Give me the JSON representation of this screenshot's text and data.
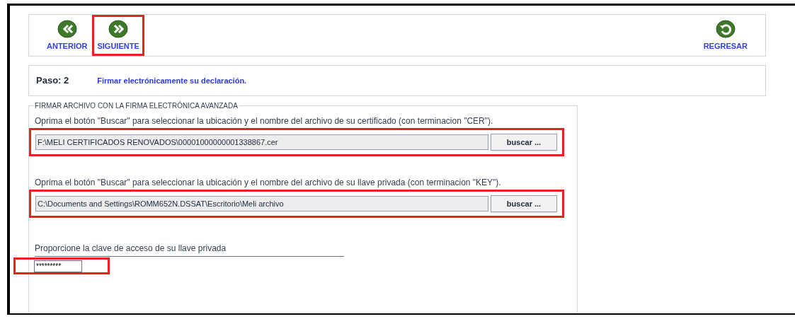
{
  "nav_buttons": [
    {
      "label": "ANTERIOR",
      "kind": "back",
      "highlighted": false
    },
    {
      "label": "SIGUIENTE",
      "kind": "forward",
      "highlighted": true
    },
    {
      "label": "REGRESAR",
      "kind": "return",
      "highlighted": false
    }
  ],
  "step": {
    "label": "Paso: 2",
    "description": "Firmar electrónicamente su declaración."
  },
  "fieldset": {
    "legend": "FIRMAR ARCHIVO CON LA FIRMA ELECTRÓNICA AVANZADA",
    "file_fields": [
      {
        "instruction": "Oprima el botón \"Buscar\" para seleccionar la ubicación y el nombre del archivo de su certificado (con terminacion \"CER\").",
        "value": "F:\\MELI CERTIFICADOS RENOVADOS\\00001000000001338867.cer",
        "button": "buscar ...",
        "highlighted": true
      },
      {
        "instruction": "Oprima el botón \"Buscar\" para seleccionar la ubicación y el nombre del archivo de su llave privada (con terminacion \"KEY\").",
        "value": "C:\\Documents and Settings\\ROMM652N.DSSAT\\Escritorio\\Meli archivo",
        "button": "buscar ...",
        "highlighted": true
      }
    ],
    "password": {
      "label": "Proporcione la clave de acceso de su llave privada",
      "value": "*********",
      "highlighted": true
    }
  }
}
